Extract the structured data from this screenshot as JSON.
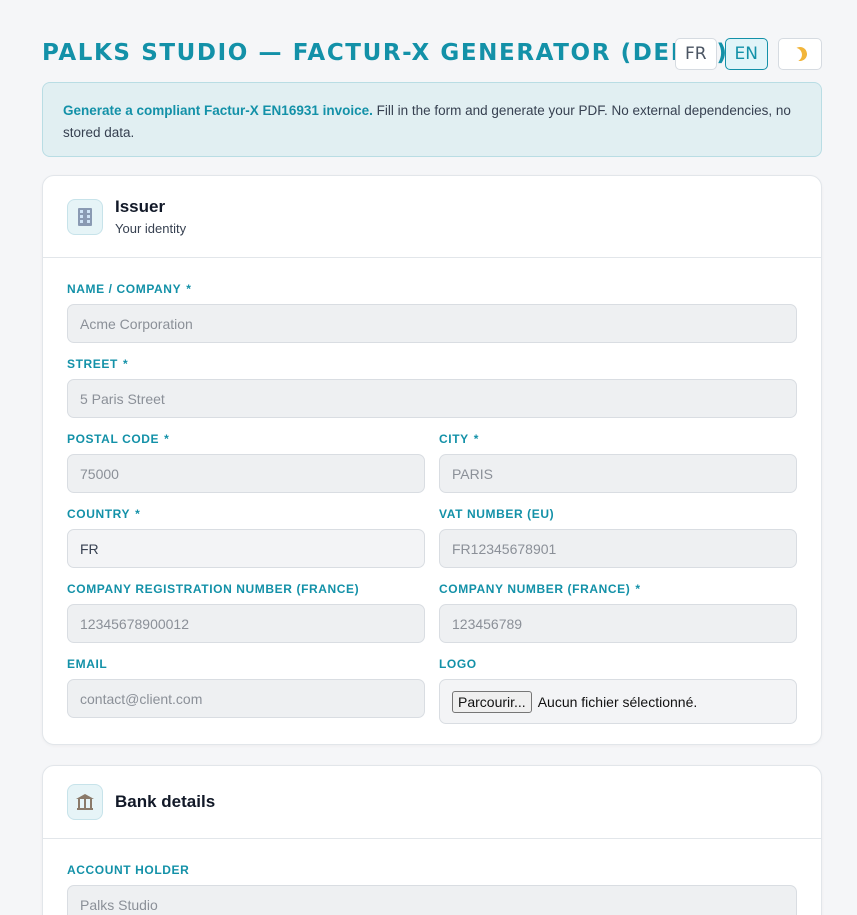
{
  "header": {
    "title": "PALKS STUDIO — FACTUR-X GENERATOR (DEMO)",
    "lang_fr": "FR",
    "lang_en": "EN",
    "active_lang": "EN",
    "theme_icon": "moon-icon"
  },
  "banner": {
    "strong": "Generate a compliant Factur-X EN16931 invoice.",
    "text": " Fill in the form and generate your PDF. No external dependencies, no stored data."
  },
  "issuer": {
    "icon": "building-icon",
    "title": "Issuer",
    "subtitle": "Your identity",
    "fields": {
      "name": {
        "label": "NAME / COMPANY",
        "required": "*",
        "placeholder": "Acme Corporation"
      },
      "street": {
        "label": "STREET",
        "required": "*",
        "placeholder": "5 Paris Street"
      },
      "postal_code": {
        "label": "POSTAL CODE",
        "required": "*",
        "placeholder": "75000"
      },
      "city": {
        "label": "CITY",
        "required": "*",
        "placeholder": "PARIS"
      },
      "country": {
        "label": "COUNTRY",
        "required": "*",
        "value": "FR"
      },
      "vat": {
        "label": "VAT NUMBER (EU)",
        "placeholder": "FR12345678901"
      },
      "registration": {
        "label": "COMPANY REGISTRATION NUMBER (FRANCE)",
        "placeholder": "12345678900012"
      },
      "company_number": {
        "label": "COMPANY NUMBER (FRANCE)",
        "required": "*",
        "placeholder": "123456789"
      },
      "email": {
        "label": "EMAIL",
        "placeholder": "contact@client.com"
      },
      "logo": {
        "label": "LOGO",
        "button": "Parcourir...",
        "status": "Aucun fichier sélectionné."
      }
    }
  },
  "bank": {
    "icon": "bank-icon",
    "title": "Bank details",
    "fields": {
      "account_holder": {
        "label": "ACCOUNT HOLDER",
        "placeholder": "Palks Studio"
      }
    }
  },
  "colors": {
    "accent": "#1391a8",
    "banner_bg": "#e1eff2",
    "page_bg": "#f5f6f8"
  }
}
